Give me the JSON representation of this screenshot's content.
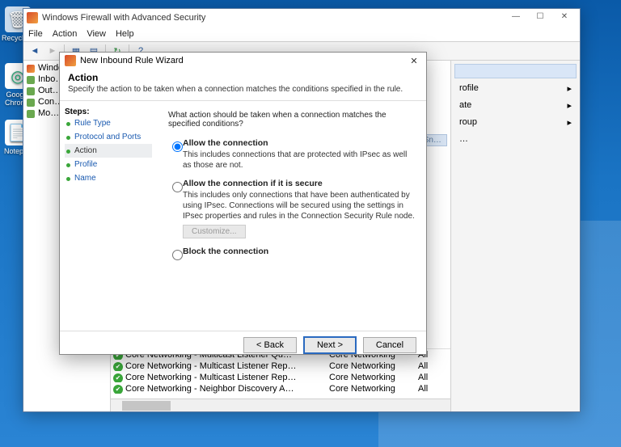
{
  "desktop": {
    "icons": [
      {
        "label": "Recycle…",
        "glyph": "🗑"
      },
      {
        "label": "Google Chrome",
        "glyph": "◎"
      },
      {
        "label": "Notepad",
        "glyph": "📄"
      }
    ]
  },
  "main_window": {
    "title": "Windows Firewall with Advanced Security",
    "menus": [
      "File",
      "Action",
      "View",
      "Help"
    ],
    "winbtns": {
      "min": "—",
      "max": "☐",
      "close": "✕"
    },
    "tree": {
      "root": "Windo…",
      "items": [
        "Inbo…",
        "Out…",
        "Con…",
        "Mo…"
      ]
    },
    "side": {
      "items": [
        "rofile",
        "ate",
        "roup"
      ]
    },
    "rules": [
      {
        "name": "Core Networking - Multicast Listener Qu…",
        "group": "Core Networking",
        "profile": "All"
      },
      {
        "name": "Core Networking - Multicast Listener Rep…",
        "group": "Core Networking",
        "profile": "All"
      },
      {
        "name": "Core Networking - Multicast Listener Rep…",
        "group": "Core Networking",
        "profile": "All"
      },
      {
        "name": "Core Networking - Neighbor Discovery A…",
        "group": "Core Networking",
        "profile": "All"
      }
    ]
  },
  "wizard": {
    "title": "New Inbound Rule Wizard",
    "heading": "Action",
    "subheading": "Specify the action to be taken when a connection matches the conditions specified in the rule.",
    "steps_label": "Steps:",
    "steps": [
      "Rule Type",
      "Protocol and Ports",
      "Action",
      "Profile",
      "Name"
    ],
    "active_step": "Action",
    "question": "What action should be taken when a connection matches the specified conditions?",
    "options": [
      {
        "label": "Allow the connection",
        "desc": "This includes connections that are protected with IPsec as well as those are not.",
        "selected": true
      },
      {
        "label": "Allow the connection if it is secure",
        "desc": "This includes only connections that have been authenticated by using IPsec.  Connections will be secured using the settings in IPsec properties and rules in the Connection Security Rule node.",
        "selected": false,
        "customize": "Customize..."
      },
      {
        "label": "Block the connection",
        "desc": "",
        "selected": false
      }
    ],
    "buttons": {
      "back": "< Back",
      "next": "Next >",
      "cancel": "Cancel"
    },
    "close": "✕"
  },
  "floating": "Rectangular Sn…"
}
